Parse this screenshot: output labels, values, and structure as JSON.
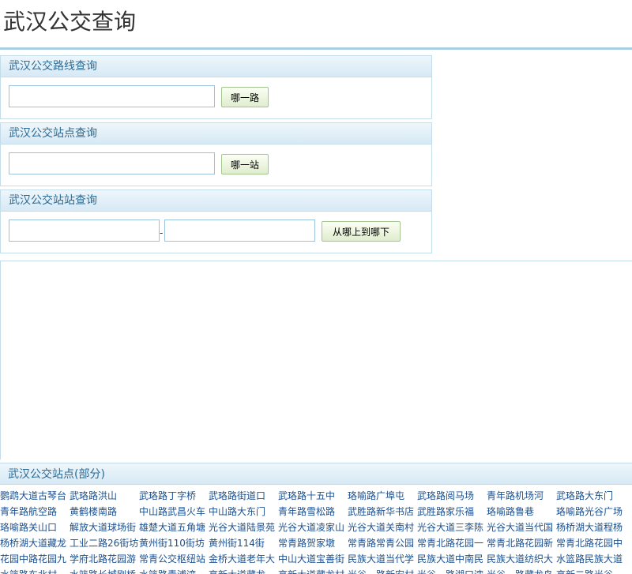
{
  "page": {
    "title": "武汉公交查询"
  },
  "route_query": {
    "title": "武汉公交路线查询",
    "input_value": "",
    "button_label": "哪一路"
  },
  "stop_query": {
    "title": "武汉公交站点查询",
    "input_value": "",
    "button_label": "哪一站"
  },
  "transfer_query": {
    "title": "武汉公交站站查询",
    "from_value": "",
    "separator": "-",
    "to_value": "",
    "button_label": "从哪上到哪下"
  },
  "stops": {
    "title": "武汉公交站点(部分)",
    "rows": [
      [
        "鹦鹉大道古琴台",
        "武珞路洪山",
        "武珞路丁字桥",
        "武珞路街道口",
        "武珞路十五中",
        "珞喻路广埠屯",
        "武珞路阅马场",
        "青年路机场河",
        "武珞路大东门"
      ],
      [
        "青年路航空路",
        "黄鹤楼南路",
        "中山路武昌火车",
        "中山路大东门",
        "青年路雪松路",
        "武胜路新华书店",
        "武胜路家乐福",
        "珞喻路鲁巷",
        "珞喻路光谷广场"
      ],
      [
        "珞喻路关山口",
        "解放大道球场街",
        "雄楚大道五角塘",
        "光谷大道陆景苑",
        "光谷大道凌家山",
        "光谷大道关南村",
        "光谷大道三李陈",
        "光谷大道当代国",
        "杨桥湖大道程杨"
      ],
      [
        "杨桥湖大道藏龙",
        "工业二路26街坊",
        "黄州街110街坊",
        "黄州街114街",
        "常青路贺家墩",
        "常青路常青公园",
        "常青北路花园一",
        "常青北路花园新",
        "常青北路花园中"
      ],
      [
        "花园中路花园九",
        "学府北路花园游",
        "常青公交枢纽站",
        "金桥大道老年大",
        "中山大道宝善街",
        "民族大道当代学",
        "民族大道中南民",
        "民族大道纺织大",
        "水篮路民族大道"
      ],
      [
        "水篮路东北村",
        "水篮路长城刚桥",
        "水篮路青浦湾",
        "高新大道藏龙",
        "高新大道藏龙村",
        "光谷一路新安村",
        "光谷一路湖口湾",
        "光谷一路藏龙岛",
        "高新二路光谷"
      ]
    ]
  }
}
